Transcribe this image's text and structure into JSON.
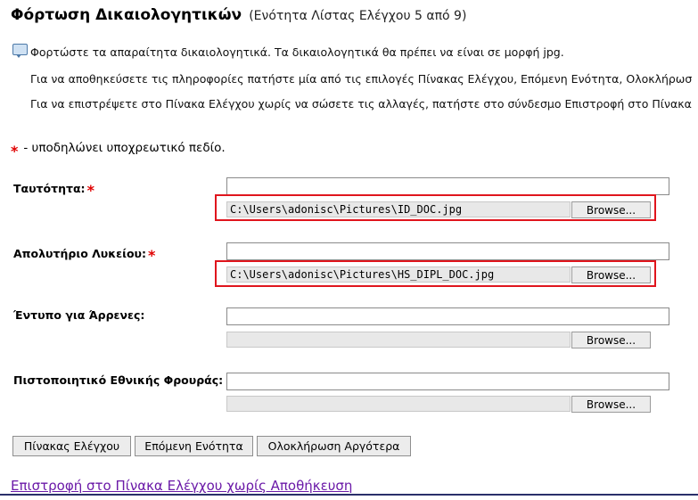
{
  "header": {
    "title": "Φόρτωση Δικαιολογητικών",
    "subtitle": "(Ενότητα Λίστας Ελέγχου 5 από 9)"
  },
  "instructions": {
    "icon": "info-icon",
    "line1": "Φορτώστε τα απαραίτητα δικαιολογητικά. Τα δικαιολογητικά θα πρέπει να είναι σε μορφή jpg.",
    "line2": "Για να αποθηκεύσετε τις πληροφορίες πατήστε μία από τις επιλογές Πίνακας Ελέγχου, Επόμενη Ενότητα, Ολοκλήρωσ",
    "line3": "Για να επιστρέψετε στο Πίνακα Ελέγχου χωρίς να σώσετε τις αλλαγές, πατήστε στο σύνδεσμο Επιστροφή στο Πίνακα"
  },
  "required_note": {
    "star": "*",
    "text": "- υποδηλώνει υποχρεωτικό πεδίο."
  },
  "fields": [
    {
      "label": "Ταυτότητα:",
      "required": true,
      "text_value": "",
      "file_path": "C:\\Users\\adonisc\\Pictures\\ID_DOC.jpg",
      "browse_label": "Browse...",
      "highlighted": true
    },
    {
      "label": "Απολυτήριο Λυκείου:",
      "required": true,
      "text_value": "",
      "file_path": "C:\\Users\\adonisc\\Pictures\\HS_DIPL_DOC.jpg",
      "browse_label": "Browse...",
      "highlighted": true
    },
    {
      "label": "Έντυπο για Άρρενες:",
      "required": false,
      "text_value": "",
      "file_path": "",
      "browse_label": "Browse...",
      "highlighted": false
    },
    {
      "label": "Πιστοποιητικό Εθνικής Φρουράς:",
      "required": false,
      "text_value": "",
      "file_path": "",
      "browse_label": "Browse...",
      "highlighted": false
    }
  ],
  "actions": {
    "dashboard": "Πίνακας Ελέγχου",
    "next": "Επόμενη Ενότητα",
    "later": "Ολοκλήρωση Αργότερα"
  },
  "back_link": "Επιστροφή στο Πίνακα Ελέγχου χωρίς Αποθήκευση",
  "colors": {
    "required_star": "#e00000",
    "highlight_border": "#e0151d",
    "link": "#6b1aa8"
  }
}
